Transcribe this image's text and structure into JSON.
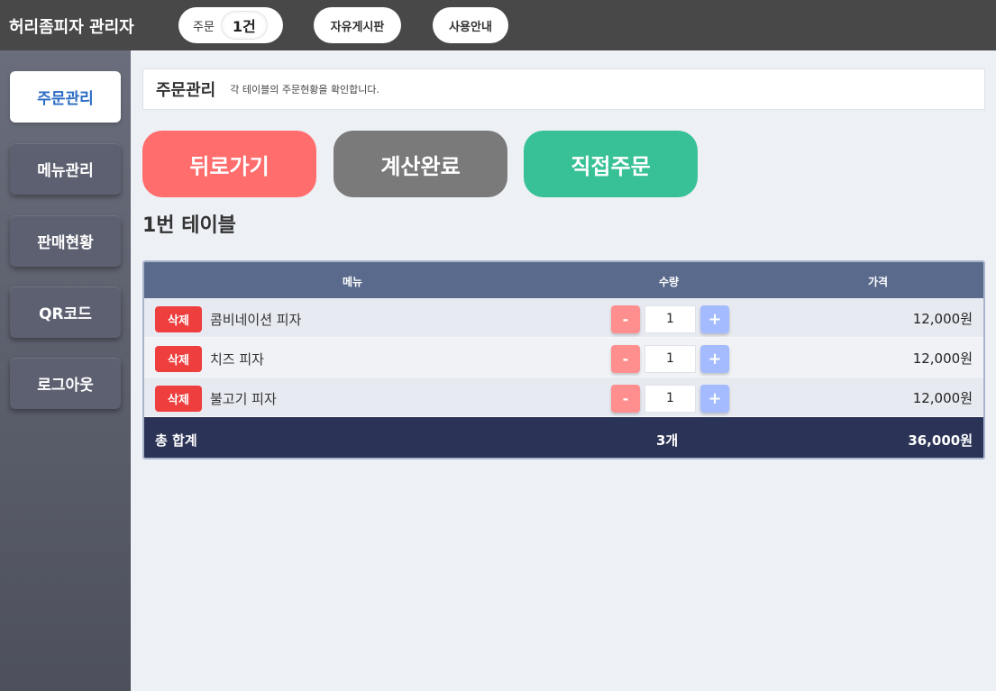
{
  "topbar": {
    "brand": "허리좀피자 관리자",
    "order_label": "주문",
    "order_count": "1건",
    "board_label": "자유게시판",
    "guide_label": "사용안내"
  },
  "sidebar": {
    "items": [
      {
        "label": "주문관리",
        "active": true
      },
      {
        "label": "메뉴관리"
      },
      {
        "label": "판매현황"
      },
      {
        "label": "QR코드"
      },
      {
        "label": "로그아웃"
      }
    ]
  },
  "header": {
    "title": "주문관리",
    "subtitle": "각 테이블의 주문현황을 확인합니다."
  },
  "actions": {
    "back": "뒤로가기",
    "done": "계산완료",
    "direct": "직접주문"
  },
  "colors": {
    "back": "#ff6d6d",
    "done": "#7a7a7a",
    "direct": "#38c196",
    "table_header": "#5a6a8d",
    "table_footer": "#2b3356",
    "delete": "#ee3e3e"
  },
  "table_title": "1번 테이블",
  "order_table": {
    "columns": [
      "메뉴",
      "수량",
      "가격"
    ],
    "delete_label": "삭제",
    "minus_label": "-",
    "plus_label": "+",
    "rows": [
      {
        "name": "콤비네이션 피자",
        "qty": "1",
        "price": "12,000원"
      },
      {
        "name": "치즈 피자",
        "qty": "1",
        "price": "12,000원"
      },
      {
        "name": "불고기 피자",
        "qty": "1",
        "price": "12,000원"
      }
    ],
    "total_label": "총 합계",
    "total_qty": "3개",
    "total_price": "36,000원"
  }
}
